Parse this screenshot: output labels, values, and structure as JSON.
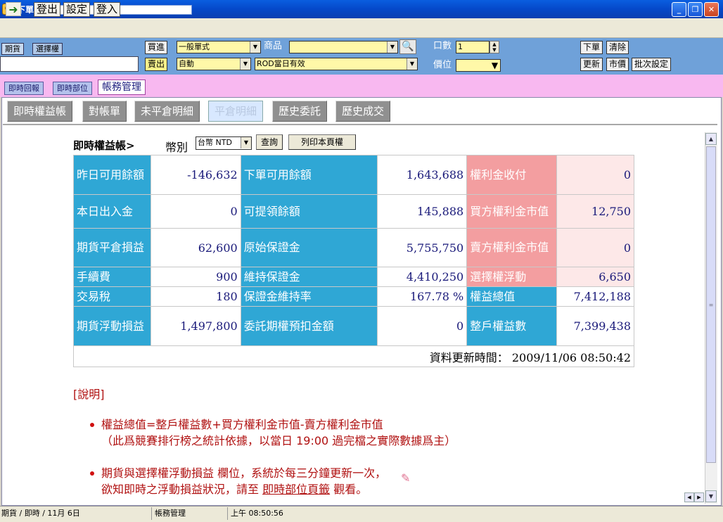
{
  "window": {
    "title": "下單帳務",
    "icon_char": "Q"
  },
  "menu": {
    "items": [
      "登出",
      "設定",
      "登入"
    ]
  },
  "order": {
    "futures_tab": "期貨",
    "options_tab": "選擇權",
    "buy_label": "買進",
    "sell_label": "賣出",
    "order_type_value": "一般單式",
    "auto_value": "自動",
    "product_label": "商品",
    "product_value": "",
    "tif_value": "ROD當日有效",
    "qty_label": "口數",
    "qty_value": "1",
    "price_label": "價位",
    "price_value": "",
    "place_order": "下單",
    "clear": "清除",
    "refresh": "更新",
    "market_price": "市價",
    "batch_settings": "批次設定"
  },
  "tabs": [
    "即時回報",
    "即時部位",
    "帳務管理"
  ],
  "subtabs": [
    "即時權益帳",
    "對帳單",
    "未平倉明細",
    "平倉明細",
    "歷史委託",
    "歷史成交"
  ],
  "account": {
    "heading": "即時權益帳>",
    "currency_label": "幣別",
    "currency_value": "台幣 NTD",
    "query_button": "查詢",
    "print_button": "列印本頁權",
    "rows": [
      {
        "k1": "昨日可用餘額",
        "v1": "-146,632",
        "k2": "下單可用餘額",
        "v2": "1,643,688",
        "k3": "權利金收付",
        "v3": "0"
      },
      {
        "k1": "本日出入金",
        "v1": "0",
        "k2": "可提領餘額",
        "v2": "145,888",
        "k3": "買方權利金市值",
        "v3": "12,750"
      },
      {
        "k1": "期貨平倉損益",
        "v1": "62,600",
        "k2": "原始保證金",
        "v2": "5,755,750",
        "k3": "賣方權利金市值",
        "v3": "0"
      },
      {
        "k1": "手續費",
        "v1": "900",
        "k2": "維持保證金",
        "v2": "4,410,250",
        "k3": "選擇權浮動",
        "v3": "6,650"
      },
      {
        "k1": "交易稅",
        "v1": "180",
        "k2": "保證金維持率",
        "v2": "167.78 %",
        "k3": "權益總值",
        "v3": "7,412,188"
      },
      {
        "k1": "期貨浮動損益",
        "v1": "1,497,800",
        "k2": "委託期權預扣金額",
        "v2": "0",
        "k3": "整戶權益數",
        "v3": "7,399,438"
      }
    ],
    "update_label": "資料更新時間：",
    "update_time": "2009/11/06 08:50:42"
  },
  "notes": {
    "title": "[說明]",
    "n1_line1": "權益總值=整戶權益數+買方權利金市值-賣方權利金市值",
    "n1_line2": "（此爲競賽排行榜之統計依據，以當日 19:00 過完檔之實際數據爲主）",
    "n2_line1": "期貨與選擇權浮動損益 欄位，系統於每三分鐘更新一次，",
    "n2_line2_pre": "欲知即時之浮動損益狀況，請至 ",
    "n2_link": "即時部位頁籤",
    "n2_line2_post": " 觀看。"
  },
  "status": {
    "left": "期貨 / 即時 / 11月 6日",
    "middle": "帳務管理",
    "time": "上午 08:50:56"
  },
  "colors": {
    "title_blue": "#0548c9",
    "cell_blue": "#2fa7d5",
    "cell_pink": "#f39ea0",
    "note_red": "#b01010",
    "tab_pink": "#f8b8f0"
  }
}
